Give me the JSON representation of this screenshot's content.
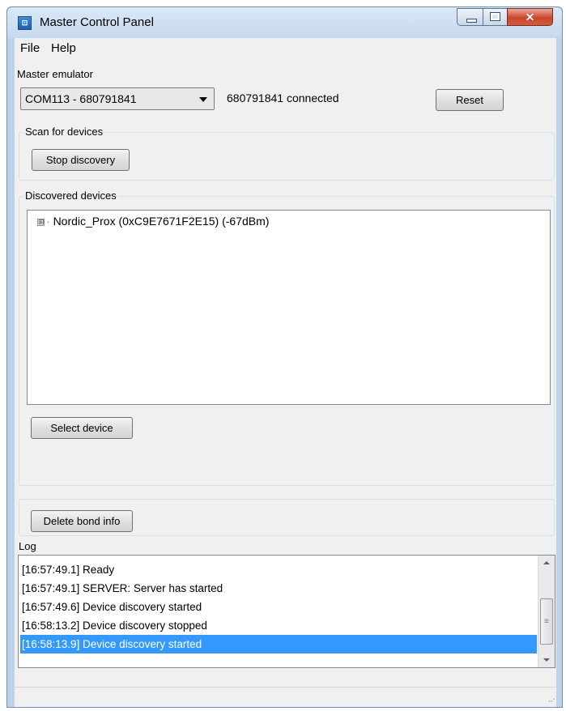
{
  "window": {
    "title": "Master Control Panel",
    "icon": "app-icon",
    "controls": {
      "minimize": "minimize-icon",
      "maximize": "maximize-icon",
      "close": "✕"
    }
  },
  "menu": {
    "file": "File",
    "help": "Help"
  },
  "master_emulator": {
    "label": "Master emulator",
    "port_selected": "COM113 - 680791841",
    "status": "680791841 connected",
    "reset_label": "Reset"
  },
  "scan": {
    "label": "Scan for devices",
    "stop_label": "Stop discovery"
  },
  "discovered": {
    "label": "Discovered devices",
    "devices": [
      {
        "expander": "⊞",
        "name": "Nordic_Prox (0xC9E7671F2E15) (-67dBm)"
      }
    ],
    "select_label": "Select device"
  },
  "bond": {
    "delete_label": "Delete bond info"
  },
  "log": {
    "label": "Log",
    "entries": [
      "[16:57:49.1] Ready",
      "[16:57:49.1] SERVER: Server has started",
      "[16:57:49.6] Device discovery started",
      "[16:58:13.2] Device discovery stopped",
      "[16:58:13.9] Device discovery started"
    ],
    "selected_index": 4,
    "scroll_grip": "≡"
  },
  "colors": {
    "selection": "#3399ff",
    "window_frame": "#bcd3ea"
  }
}
